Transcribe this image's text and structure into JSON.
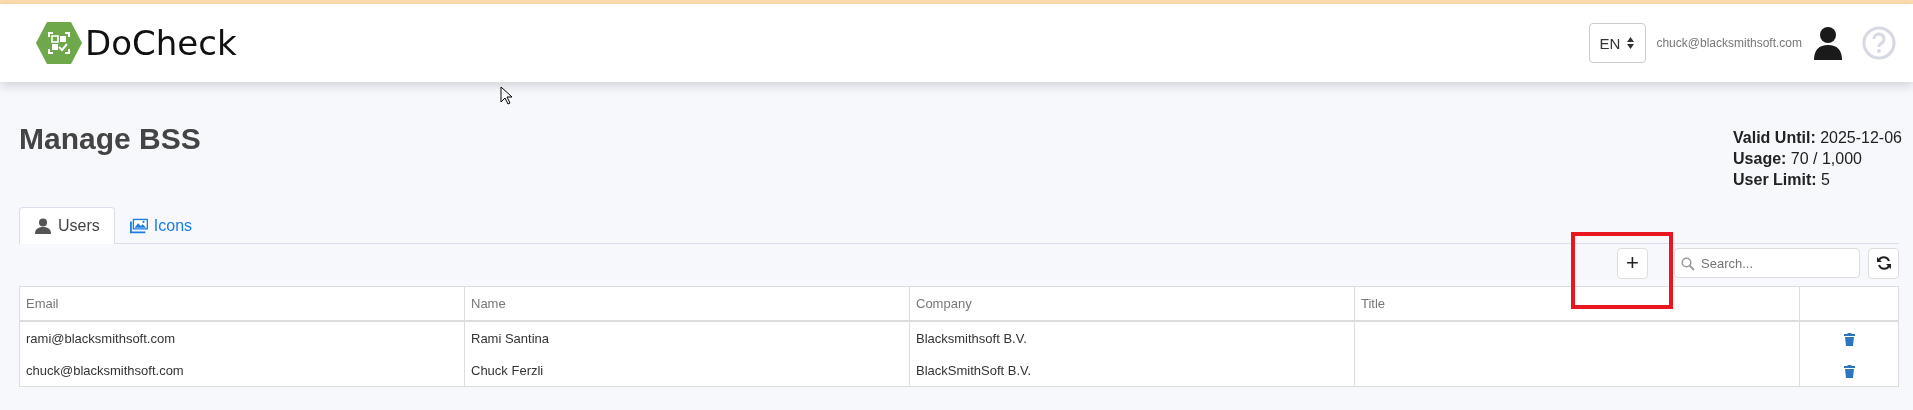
{
  "header": {
    "app_name": "DoCheck",
    "language": "EN",
    "user_email": "chuck@blacksmithsoft.com"
  },
  "page": {
    "title": "Manage BSS",
    "info": [
      {
        "label": "Valid Until:",
        "value": "2025-12-06"
      },
      {
        "label": "Usage:",
        "value": "70 / 1,000"
      },
      {
        "label": "User Limit:",
        "value": "5"
      }
    ]
  },
  "tabs": [
    {
      "label": "Users",
      "kind": "user",
      "selected": true
    },
    {
      "label": "Icons",
      "kind": "images",
      "selected": false
    }
  ],
  "toolbar": {
    "add_button": "+",
    "search": {
      "placeholder": "Search..."
    }
  },
  "table": {
    "columns": [
      "Email",
      "Name",
      "Company",
      "Title"
    ],
    "rows": [
      {
        "cells": [
          "rami@blacksmithsoft.com",
          "Rami Santina",
          "Blacksmithsoft B.V.",
          ""
        ]
      },
      {
        "cells": [
          "chuck@blacksmithsoft.com",
          "Chuck Ferzli",
          "BlackSmithSoft B.V.",
          ""
        ]
      }
    ]
  }
}
